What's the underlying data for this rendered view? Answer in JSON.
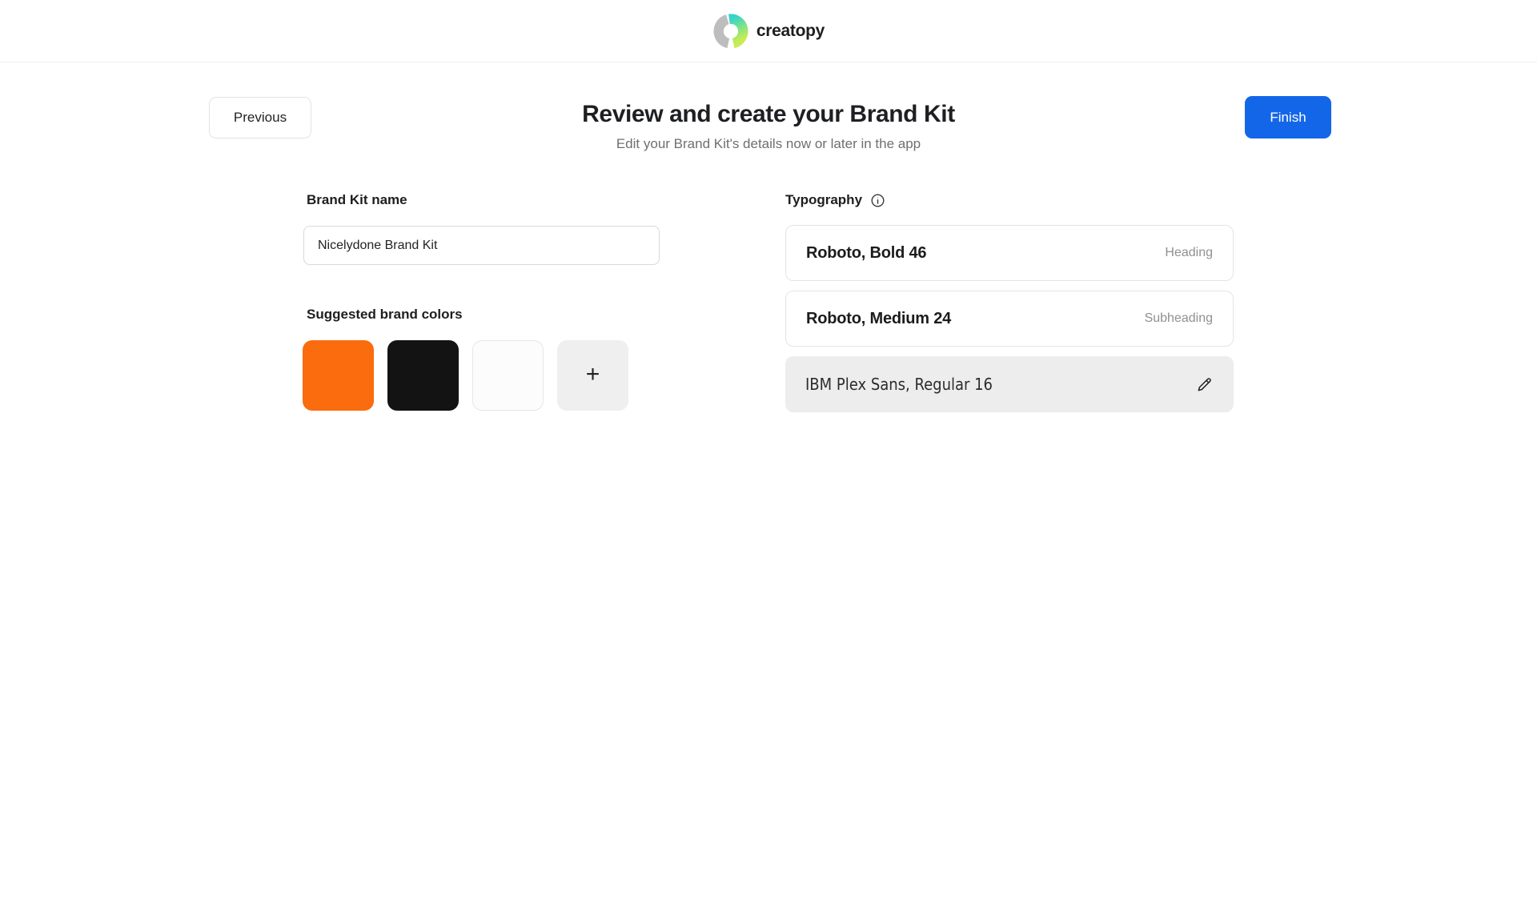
{
  "header": {
    "logo_text": "creatopy"
  },
  "actions": {
    "previous_label": "Previous",
    "finish_label": "Finish"
  },
  "page": {
    "title": "Review and create your Brand Kit",
    "subtitle": "Edit your Brand Kit's details now or later in the app"
  },
  "brand_kit": {
    "name_label": "Brand Kit name",
    "name_value": "Nicelydone Brand Kit",
    "colors_label": "Suggested brand colors",
    "swatches": [
      {
        "name": "orange",
        "hex": "#fa6c0e"
      },
      {
        "name": "black",
        "hex": "#131313"
      },
      {
        "name": "white",
        "hex": "#fcfcfc"
      }
    ],
    "add_color_glyph": "+"
  },
  "typography": {
    "label": "Typography",
    "rows": [
      {
        "font": "Roboto, Bold 46",
        "tag": "Heading"
      },
      {
        "font": "Roboto, Medium 24",
        "tag": "Subheading"
      },
      {
        "font": "IBM Plex Sans, Regular 16",
        "tag": ""
      }
    ]
  },
  "colors": {
    "accent_blue": "#1466e8",
    "logo_gray": "#bdbdbd",
    "logo_gradient_top": "#35d4cb",
    "logo_gradient_mid": "#7ce18b",
    "logo_gradient_bottom": "#c8ec53"
  }
}
